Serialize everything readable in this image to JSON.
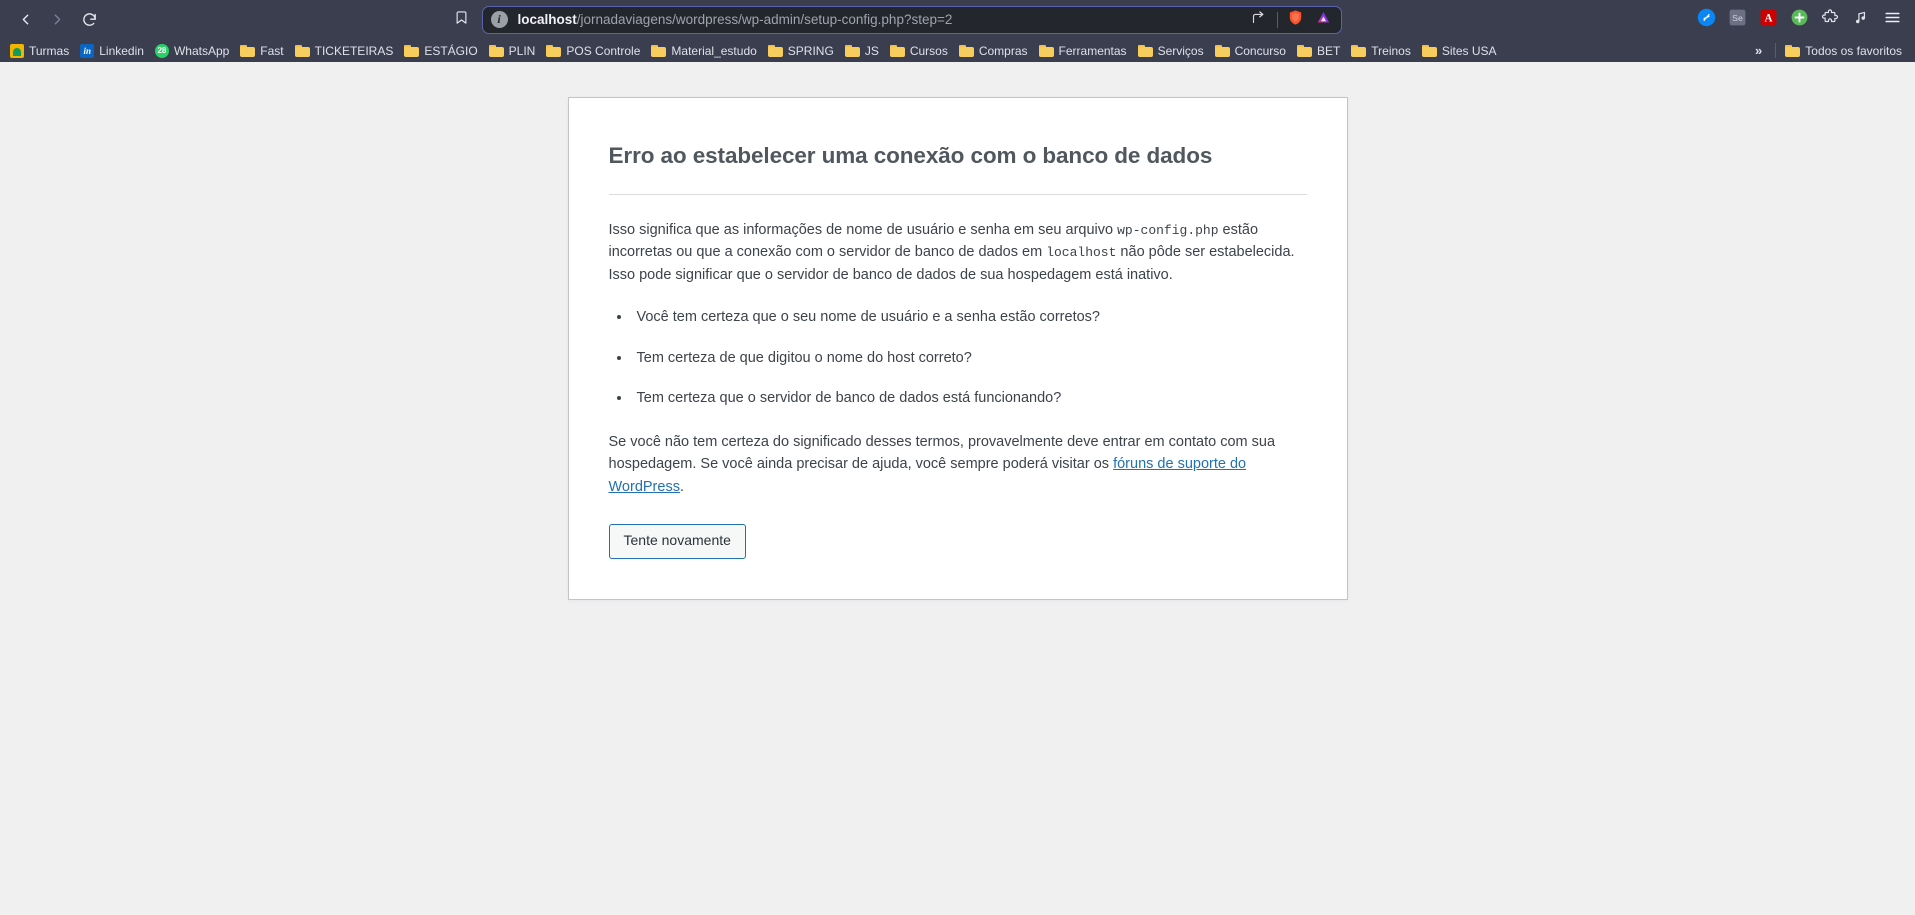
{
  "browser": {
    "nav": {
      "back_icon": "chevron-left-icon",
      "forward_icon": "chevron-right-icon",
      "reload_icon": "reload-icon"
    },
    "bookmark_star_icon": "bookmark-icon",
    "omnibox": {
      "info_icon": "info-icon",
      "info_glyph": "i",
      "host": "localhost",
      "path": "/jornadaviagens/wordpress/wp-admin/setup-config.php?step=2",
      "full_url": "localhost/jornadaviagens/wordpress/wp-admin/setup-config.php?step=2",
      "share_icon": "share-icon",
      "shield_icon": "brave-shields-icon",
      "leo_icon": "brave-leo-ai-icon"
    },
    "extensions": [
      {
        "name": "shazam-extension-icon",
        "glyph": "S",
        "color": "#0a86f5"
      },
      {
        "name": "selenium-ide-extension-icon",
        "glyph": "Se",
        "color": "#7c7f8f"
      },
      {
        "name": "adobe-acrobat-extension-icon",
        "glyph": "A",
        "color": "#cc0000"
      },
      {
        "name": "add-extension-icon",
        "glyph": "+",
        "color": "#4caf50"
      },
      {
        "name": "extensions-puzzle-icon",
        "glyph": "",
        "color": "#dfe1ea"
      },
      {
        "name": "music-extension-icon",
        "glyph": "",
        "color": "#dfe1ea"
      }
    ],
    "menu_icon": "hamburger-menu-icon",
    "bookmarks": [
      {
        "label": "Turmas",
        "icon": "google-classroom-favicon",
        "type": "site",
        "fav_class": "fav-classroom",
        "glyph": ""
      },
      {
        "label": "Linkedin",
        "icon": "linkedin-favicon",
        "type": "site",
        "fav_class": "fav-linkedin",
        "glyph": "in"
      },
      {
        "label": "WhatsApp",
        "icon": "whatsapp-favicon",
        "type": "site",
        "fav_class": "fav-whatsapp",
        "glyph": "28"
      },
      {
        "label": "Fast",
        "icon": "folder-icon",
        "type": "folder"
      },
      {
        "label": "TICKETEIRAS",
        "icon": "folder-icon",
        "type": "folder"
      },
      {
        "label": "ESTÁGIO",
        "icon": "folder-icon",
        "type": "folder"
      },
      {
        "label": "PLIN",
        "icon": "folder-icon",
        "type": "folder"
      },
      {
        "label": "POS Controle",
        "icon": "folder-icon",
        "type": "folder"
      },
      {
        "label": "Material_estudo",
        "icon": "folder-icon",
        "type": "folder"
      },
      {
        "label": "SPRING",
        "icon": "folder-icon",
        "type": "folder"
      },
      {
        "label": "JS",
        "icon": "folder-icon",
        "type": "folder"
      },
      {
        "label": "Cursos",
        "icon": "folder-icon",
        "type": "folder"
      },
      {
        "label": "Compras",
        "icon": "folder-icon",
        "type": "folder"
      },
      {
        "label": "Ferramentas",
        "icon": "folder-icon",
        "type": "folder"
      },
      {
        "label": "Serviços",
        "icon": "folder-icon",
        "type": "folder"
      },
      {
        "label": "Concurso",
        "icon": "folder-icon",
        "type": "folder"
      },
      {
        "label": "BET",
        "icon": "folder-icon",
        "type": "folder"
      },
      {
        "label": "Treinos",
        "icon": "folder-icon",
        "type": "folder"
      },
      {
        "label": "Sites USA",
        "icon": "folder-icon",
        "type": "folder"
      }
    ],
    "bookmarks_overflow_glyph": "»",
    "all_bookmarks_label": "Todos os favoritos"
  },
  "page": {
    "title": "Erro ao estabelecer uma conexão com o banco de dados",
    "paragraph_1_part_1": "Isso significa que as informações de nome de usuário e senha em seu arquivo ",
    "paragraph_1_code_1": "wp-config.php",
    "paragraph_1_part_2": " estão incorretas ou que a conexão com o servidor de banco de dados em ",
    "paragraph_1_code_2": "localhost",
    "paragraph_1_part_3": " não pôde ser estabelecida. Isso pode significar que o servidor de banco de dados de sua hospedagem está inativo.",
    "checklist": [
      "Você tem certeza que o seu nome de usuário e a senha estão corretos?",
      "Tem certeza de que digitou o nome do host correto?",
      "Tem certeza que o servidor de banco de dados está funcionando?"
    ],
    "paragraph_2_part_1": "Se você não tem certeza do significado desses termos, provavelmente deve entrar em contato com sua hospedagem. Se você ainda precisar de ajuda, você sempre poderá visitar os ",
    "paragraph_2_link": "fóruns de suporte do WordPress",
    "paragraph_2_part_2": ".",
    "retry_button": "Tente novamente",
    "colors": {
      "accent": "#2271b1",
      "page_bg": "#f0f0f1",
      "card_bg": "#ffffff",
      "text": "#3c434a",
      "heading": "#50575e"
    }
  }
}
